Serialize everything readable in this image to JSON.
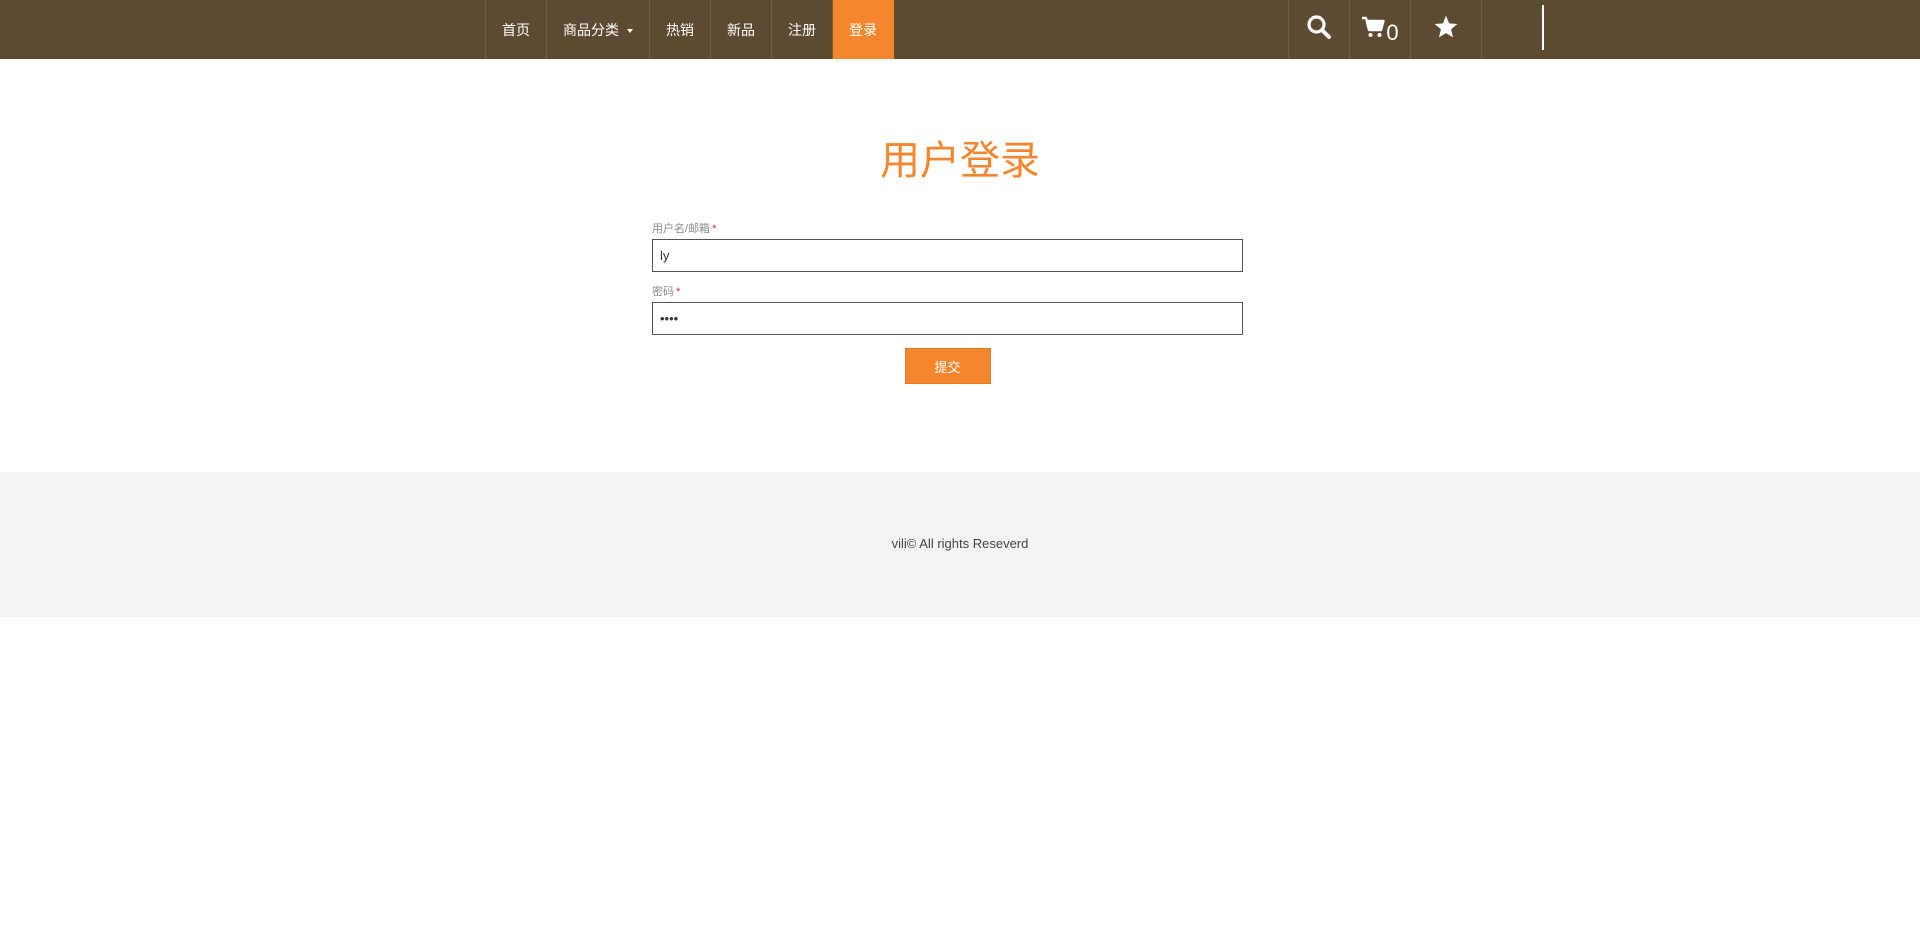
{
  "nav": {
    "items": [
      {
        "label": "首页"
      },
      {
        "label": "商品分类"
      },
      {
        "label": "热销"
      },
      {
        "label": "新品"
      },
      {
        "label": "注册"
      },
      {
        "label": "登录"
      }
    ],
    "active_index": 5
  },
  "tools": {
    "search_icon": "search-icon",
    "cart_icon": "cart-icon",
    "cart_count": "0",
    "favorites_icon": "star-icon"
  },
  "login": {
    "title": "用户登录",
    "username_label": "用户名/邮箱",
    "username_value": "ly",
    "password_label": "密码",
    "password_value": "1234",
    "required_mark": "*",
    "submit_label": "提交"
  },
  "footer": {
    "text": "vili© All rights Reseverd"
  },
  "colors": {
    "topbar": "#5d4a32",
    "accent": "#f5862e",
    "footer_bg": "#f2f4f5",
    "required": "#e0262b"
  }
}
